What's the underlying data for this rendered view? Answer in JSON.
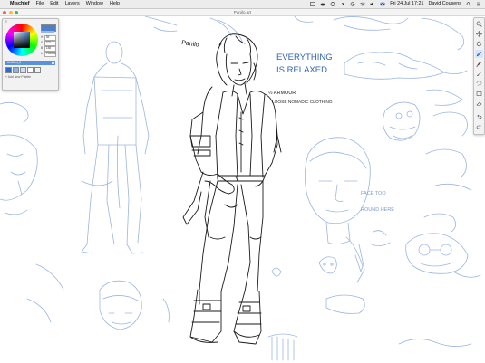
{
  "menubar": {
    "app_name": "Mischief",
    "menus": [
      "File",
      "Edit",
      "Layers",
      "Window",
      "Help"
    ],
    "date_time": "Fri 24 Jul  17:21",
    "user": "David Cousens"
  },
  "window": {
    "title": "Panilo.art"
  },
  "color_panel": {
    "current_color": "#4f7fc6",
    "fields": [
      {
        "label": "H",
        "value": "85"
      },
      {
        "label": "S",
        "value": "101"
      },
      {
        "label": "B",
        "value": "188"
      },
      {
        "label": "#",
        "value": "705898"
      }
    ],
    "palette_name": "Untitled_2",
    "swatches": [
      "#2d6dc9",
      "#8fb2e6",
      "#cfdcf1",
      "#ffffff",
      "#f2f2f2"
    ],
    "add_palette_label": "+ Add New Palette"
  },
  "toolbar": {
    "tools": [
      {
        "name": "zoom-tool-icon"
      },
      {
        "name": "pan-tool-icon"
      },
      {
        "name": "rotate-tool-icon"
      },
      {
        "name": "pencil-tool-icon",
        "active": true
      },
      {
        "name": "marker-tool-icon"
      },
      {
        "name": "brush-tool-icon"
      },
      {
        "name": "lasso-tool-icon"
      },
      {
        "name": "rectangle-tool-icon"
      },
      {
        "name": "eraser-tool-icon"
      },
      {
        "name": "undo-icon"
      },
      {
        "name": "redo-icon"
      }
    ]
  },
  "canvas_text": {
    "name_tag": "Panilo",
    "headline_1": "EVERYTHING",
    "headline_2": "IS RELAXED",
    "note_1": "½ ARMOUR",
    "note_2": "LOOSE NOMADIC CLOTHING",
    "side_note_1": "FACE TOO",
    "side_note_2": "ROUND HERE"
  }
}
